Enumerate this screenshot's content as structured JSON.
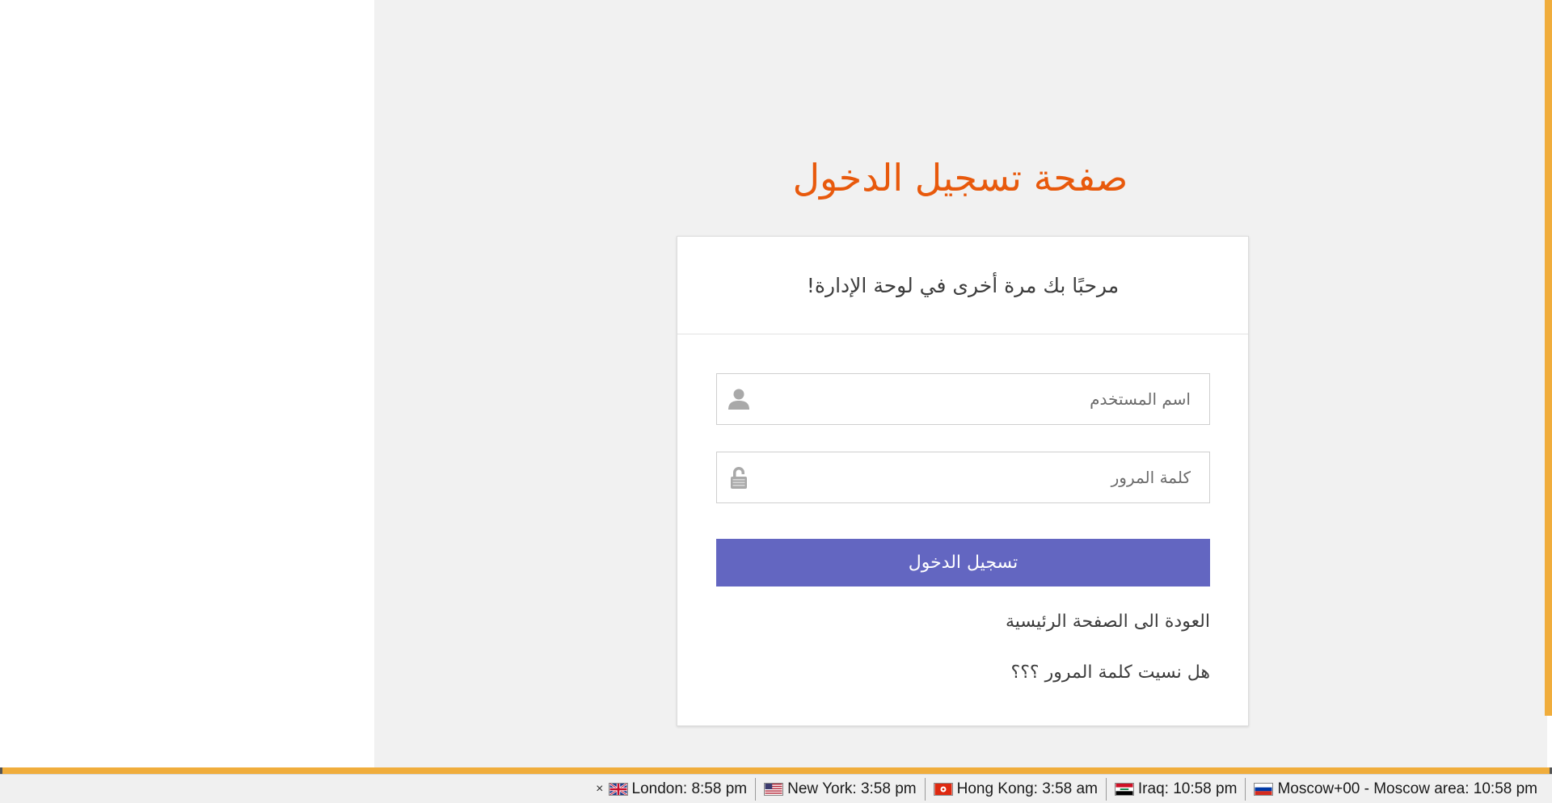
{
  "login": {
    "page_title": "صفحة تسجيل الدخول",
    "welcome": "مرحبًا بك مرة أخرى في لوحة الإدارة!",
    "username_placeholder": "اسم المستخدم",
    "password_placeholder": "كلمة المرور",
    "submit_label": "تسجيل الدخول",
    "home_link": "العودة الى الصفحة الرئيسية",
    "forgot_link": "هل نسيت كلمة المرور ؟؟؟",
    "icons": {
      "username": "user-icon",
      "password": "lock-icon"
    }
  },
  "colors": {
    "title": "#e8590c",
    "button": "#6366c1",
    "accent": "#f0ad3c",
    "main_background": "#f1f1f1"
  },
  "world_clock": {
    "close_label": "×",
    "items": [
      {
        "label": "London: 8:58 pm",
        "flag": "uk-flag-icon"
      },
      {
        "label": "New York: 3:58 pm",
        "flag": "us-flag-icon"
      },
      {
        "label": "Hong Kong: 3:58 am",
        "flag": "hong-kong-flag-icon"
      },
      {
        "label": "Iraq: 10:58 pm",
        "flag": "iraq-flag-icon"
      },
      {
        "label": "Moscow+00 - Moscow area: 10:58 pm",
        "flag": "russia-flag-icon"
      }
    ]
  }
}
